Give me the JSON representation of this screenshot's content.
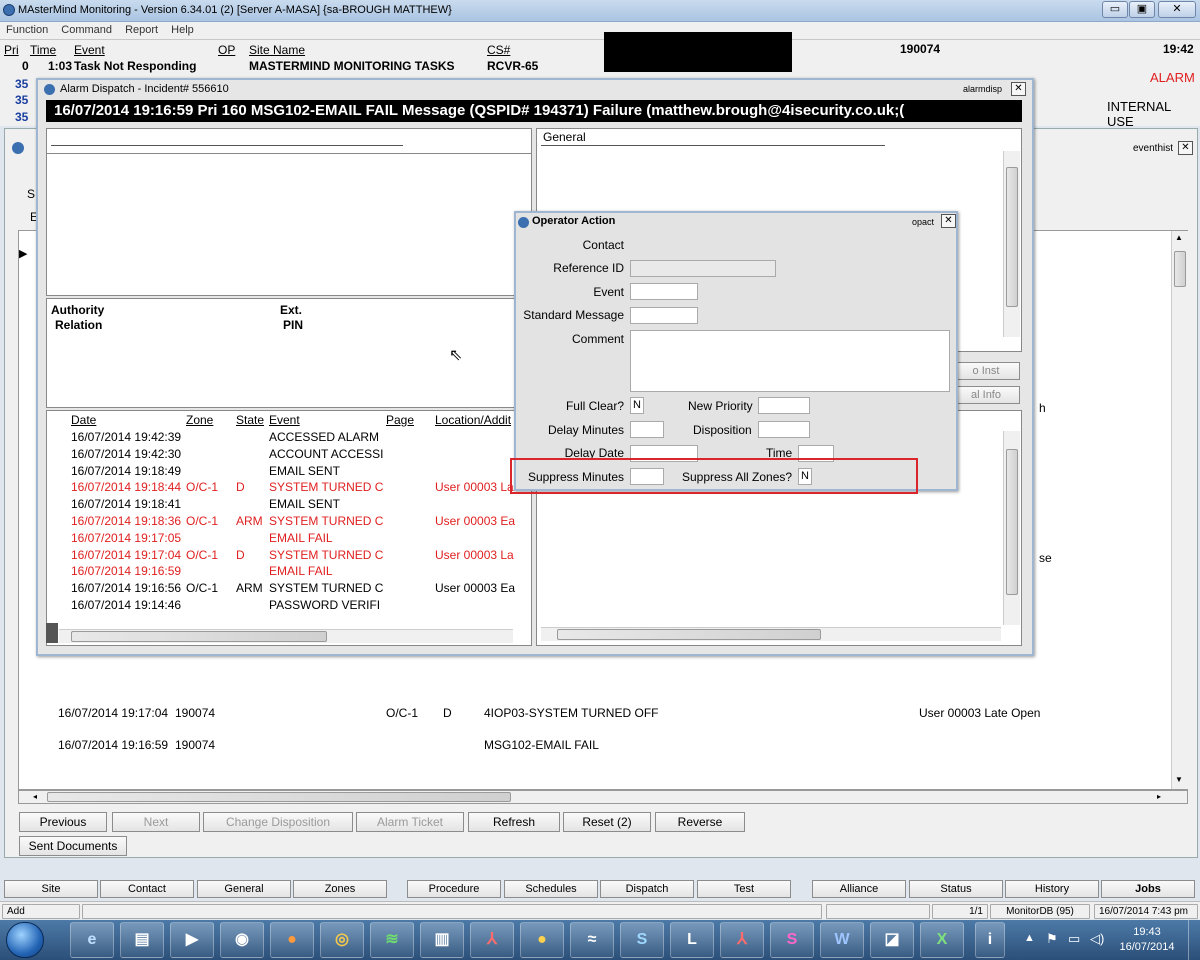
{
  "window": {
    "title": "MAsterMind Monitoring - Version 6.34.01 (2)  [Server A-MASA]  {sa-BROUGH MATTHEW}"
  },
  "menu": [
    "Function",
    "Command",
    "Report",
    "Help"
  ],
  "top_header": {
    "pri": "Pri",
    "time": "Time",
    "event": "Event",
    "op": "OP",
    "site_name": "Site Name",
    "cs": "CS#"
  },
  "top_row": {
    "pri": "0",
    "time": "1:03",
    "event": "Task Not Responding",
    "site_name": "MASTERMIND MONITORING TASKS",
    "cs": "RCVR-65"
  },
  "top_pri_rows": [
    "35",
    "35",
    "35"
  ],
  "top_right": {
    "account": "190074",
    "clock": "19:42",
    "alarm": "ALARM",
    "internal": "INTERNAL USE"
  },
  "eventhist": {
    "close_label": "eventhist",
    "s_label": "S",
    "e_label": "E"
  },
  "alarm_dispatch": {
    "title": "Alarm Dispatch - Incident# 556610",
    "close_label": "alarmdisp",
    "header": "16/07/2014 19:16:59 Pri 160 MSG102-EMAIL FAIL Message (QSPID# 194371)  Failure (matthew.brough@4isecurity.co.uk;(",
    "general_label": "General",
    "authority": "Authority",
    "relation": "Relation",
    "ext": "Ext.",
    "pin": "PIN",
    "btn_to_inst": "o Inst",
    "btn_gen_info": "al Info",
    "table_headers": {
      "date": "Date",
      "zone": "Zone",
      "state": "State",
      "event": "Event",
      "page": "Page",
      "location": "Location/Addit"
    },
    "rows": [
      {
        "date": "16/07/2014 19:42:39",
        "zone": "",
        "state": "",
        "event": "ACCESSED ALARM",
        "loc": "",
        "red": false
      },
      {
        "date": "16/07/2014 19:42:30",
        "zone": "",
        "state": "",
        "event": "ACCOUNT ACCESSI",
        "loc": "",
        "red": false
      },
      {
        "date": "16/07/2014 19:18:49",
        "zone": "",
        "state": "",
        "event": "EMAIL SENT",
        "loc": "",
        "red": false
      },
      {
        "date": "16/07/2014 19:18:44",
        "zone": "O/C-1",
        "state": "D",
        "event": "SYSTEM TURNED C",
        "loc": "User 00003 La",
        "red": true
      },
      {
        "date": "16/07/2014 19:18:41",
        "zone": "",
        "state": "",
        "event": "EMAIL SENT",
        "loc": "",
        "red": false
      },
      {
        "date": "16/07/2014 19:18:36",
        "zone": "O/C-1",
        "state": "ARM",
        "event": "SYSTEM TURNED C",
        "loc": "User 00003 Ea",
        "red": true
      },
      {
        "date": "16/07/2014 19:17:05",
        "zone": "",
        "state": "",
        "event": "EMAIL FAIL",
        "loc": "",
        "red": true
      },
      {
        "date": "16/07/2014 19:17:04",
        "zone": "O/C-1",
        "state": "D",
        "event": "SYSTEM TURNED C",
        "loc": "User 00003 La",
        "red": true
      },
      {
        "date": "16/07/2014 19:16:59",
        "zone": "",
        "state": "",
        "event": "EMAIL FAIL",
        "loc": "",
        "red": true
      },
      {
        "date": "16/07/2014 19:16:56",
        "zone": "O/C-1",
        "state": "ARM",
        "event": "SYSTEM TURNED C",
        "loc": "User 00003 Ea",
        "red": false
      },
      {
        "date": "16/07/2014 19:14:46",
        "zone": "",
        "state": "",
        "event": "PASSWORD VERIFI",
        "loc": "",
        "red": false
      }
    ]
  },
  "operator_action": {
    "title": "Operator Action",
    "close_label": "opact",
    "contact": "Contact",
    "reference_id": "Reference ID",
    "event": "Event",
    "standard_message": "Standard Message",
    "comment": "Comment",
    "full_clear": "Full Clear?",
    "full_clear_value": "N",
    "new_priority": "New Priority",
    "delay_minutes": "Delay Minutes",
    "disposition": "Disposition",
    "delay_date": "Delay Date",
    "time": "Time",
    "suppress_minutes": "Suppress Minutes",
    "suppress_all_zones": "Suppress All Zones?",
    "suppress_all_value": "N"
  },
  "history_rows": [
    {
      "date": "16/07/2014 19:17:04",
      "account": "190074",
      "zone": "O/C-1",
      "state": "D",
      "event": "4IOP03-SYSTEM TURNED OFF",
      "loc": "User 00003 Late Open"
    },
    {
      "date": "16/07/2014 19:16:59",
      "account": "190074",
      "zone": "",
      "state": "",
      "event": "MSG102-EMAIL FAIL",
      "loc": ""
    }
  ],
  "history_side_text": {
    "h": "h",
    "se": "se"
  },
  "buttons": {
    "previous": "Previous",
    "next": "Next",
    "change_disposition": "Change Disposition",
    "alarm_ticket": "Alarm Ticket",
    "refresh": "Refresh",
    "reset": "Reset (2)",
    "reverse": "Reverse",
    "sent_documents": "Sent Documents"
  },
  "bottom_tabs": [
    "Site",
    "Contact",
    "General",
    "Zones",
    "Procedure",
    "Schedules",
    "Dispatch",
    "Test",
    "Alliance",
    "Status",
    "History",
    "Jobs"
  ],
  "status": {
    "left": "Add",
    "page": "1/1",
    "db": "MonitorDB (95)",
    "datetime": "16/07/2014 7:43 pm"
  },
  "taskbar": {
    "time": "19:43",
    "date": "16/07/2014"
  },
  "colors": {
    "accent_red": "#e02020",
    "highlight_box": "#d9262c",
    "black_header": "#000000"
  }
}
